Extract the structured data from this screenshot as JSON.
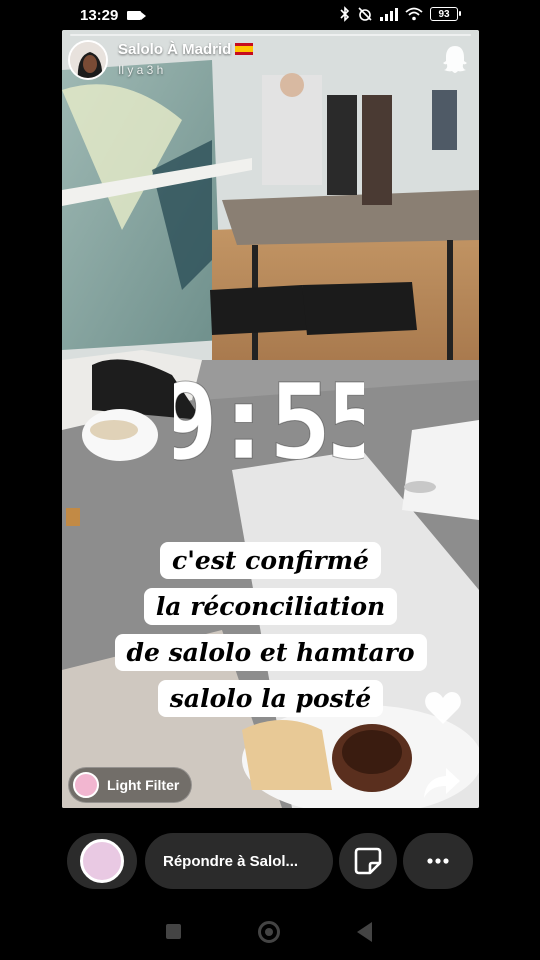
{
  "status_bar": {
    "time": "13:29",
    "battery": "93"
  },
  "story": {
    "username": "Salolo À Madrid",
    "time_ago": "Il y a 3 h",
    "clock_sticker": "9:55",
    "caption_lines": [
      "c'est confirmé",
      "la réconciliation",
      "de salolo et hamtaro",
      "salolo la posté"
    ],
    "lens_label": "Light Filter"
  },
  "bottom_bar": {
    "reply_placeholder": "Répondre à Salol..."
  },
  "icons": {
    "status": [
      "video-camera-icon",
      "bluetooth-icon",
      "alarm-off-icon",
      "signal-icon",
      "wifi-icon",
      "battery-icon"
    ],
    "story": [
      "ghost-icon",
      "heart-icon",
      "share-arrow-icon"
    ],
    "bottom": [
      "camera-icon",
      "sticker-icon",
      "more-icon"
    ],
    "nav": [
      "recents-icon",
      "home-icon",
      "back-icon"
    ]
  },
  "colors": {
    "background": "#000000",
    "pill": "#2b2b2b",
    "lens": "#f2b6d0",
    "caption_bg": "#ffffff"
  }
}
